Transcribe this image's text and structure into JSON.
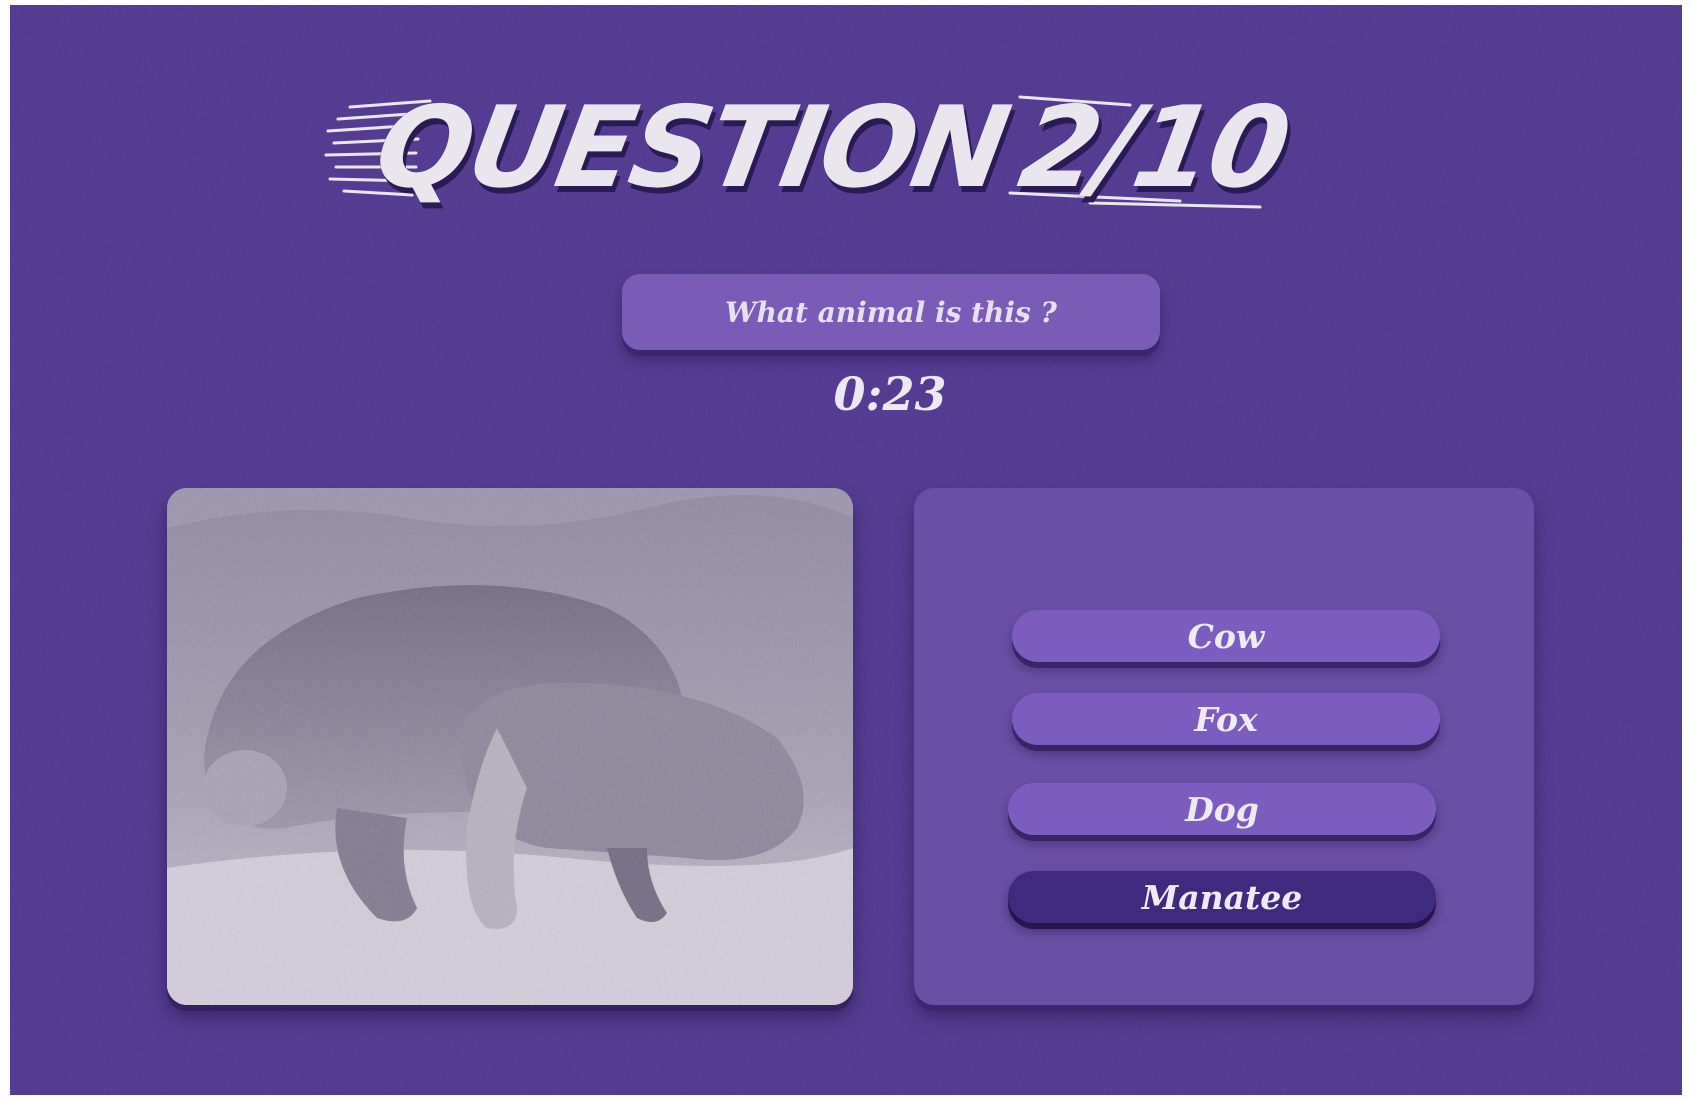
{
  "header": {
    "title_word": "QUESTION",
    "title_progress": "2/10"
  },
  "question": {
    "text": "What animal is this ?",
    "timer": "0:23"
  },
  "image": {
    "subject": "manatee-photo"
  },
  "answers": [
    {
      "label": "Cow",
      "selected": false
    },
    {
      "label": "Fox",
      "selected": false
    },
    {
      "label": "Dog",
      "selected": false
    },
    {
      "label": "Manatee",
      "selected": true
    }
  ],
  "colors": {
    "background": "#4f3490",
    "pill": "#7a5bb8",
    "answer": "#7d5cc0",
    "answer_selected": "#3f2a80",
    "panel": "#6a4fa6",
    "text": "#ece8f4"
  }
}
